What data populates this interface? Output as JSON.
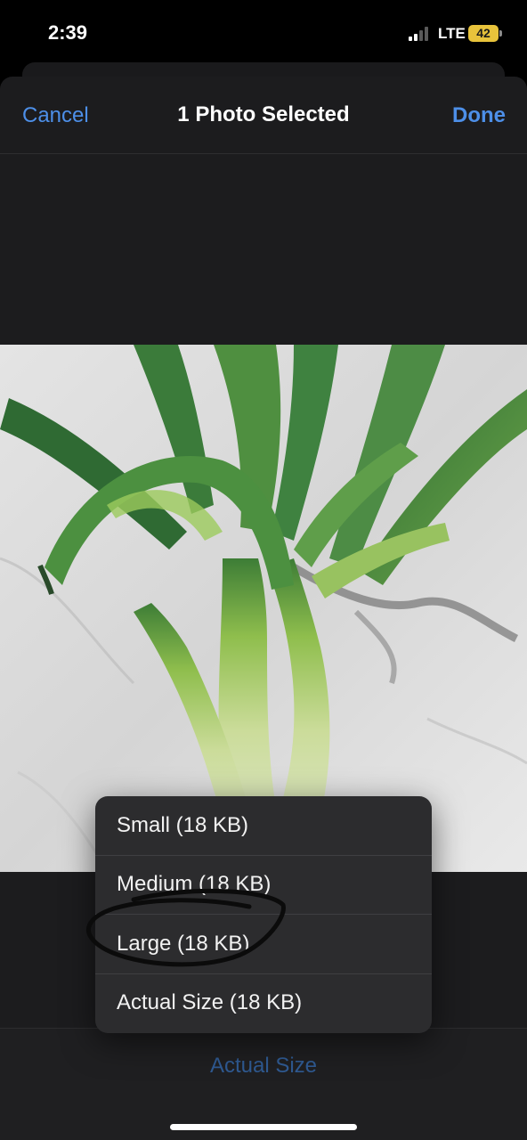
{
  "status_bar": {
    "time": "2:39",
    "network": "LTE",
    "battery": "42"
  },
  "nav": {
    "cancel_label": "Cancel",
    "title": "1 Photo Selected",
    "done_label": "Done"
  },
  "size_menu": {
    "items": [
      {
        "label": "Small (18 KB)"
      },
      {
        "label": "Medium (18 KB)"
      },
      {
        "label": "Large (18 KB)"
      },
      {
        "label": "Actual Size (18 KB)"
      }
    ]
  },
  "toolbar": {
    "selected_size_label": "Actual Size"
  },
  "colors": {
    "accent": "#4d8fe8",
    "sheet_background": "#1c1c1e",
    "menu_background": "#2c2c2e",
    "battery": "#e8c33b"
  },
  "icons": [
    "cellular-signal-icon",
    "battery-icon"
  ]
}
